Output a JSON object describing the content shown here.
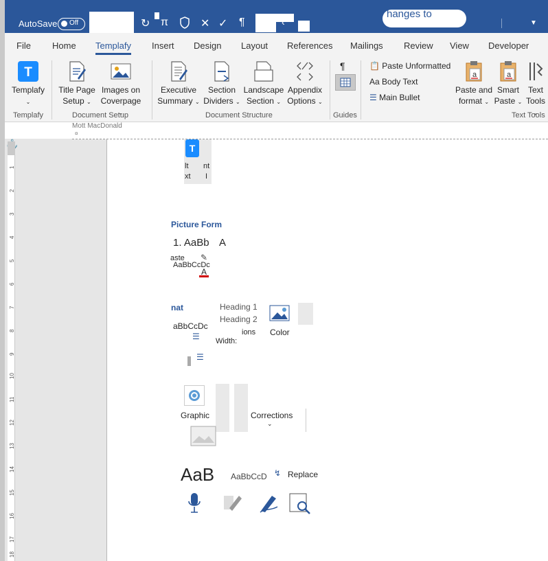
{
  "titlebar": {
    "autosave_label": "AutoSave",
    "autosave_state": "Off",
    "doc_title_fragment": "hanges to",
    "qa_icons": [
      "undo-icon",
      "pi-icon",
      "shield-icon",
      "close-x-icon",
      "check-icon",
      "pilcrow-icon",
      "stamp-icon",
      "back-arrow-icon"
    ]
  },
  "tabs": [
    "File",
    "Home",
    "Templafy",
    "Insert",
    "Design",
    "Layout",
    "References",
    "Mailings",
    "Review",
    "View",
    "Developer"
  ],
  "active_tab": "Templafy",
  "ribbon": {
    "groups": {
      "templafy": "Templafy",
      "document_setup": "Document Setup",
      "document_structure": "Document Structure",
      "guides": "Guides",
      "text_tools": "Text Tools"
    },
    "buttons": {
      "templafy": "Templafy",
      "title_page_1": "Title Page",
      "title_page_2": "Setup",
      "images_1": "Images on",
      "images_2": "Coverpage",
      "exec_1": "Executive",
      "exec_2": "Summary",
      "section_1": "Section",
      "section_2": "Dividers",
      "landscape_1": "Landscape",
      "landscape_2": "Section",
      "appendix_1": "Appendix",
      "appendix_2": "Options",
      "paste_unformatted": "Paste Unformatted",
      "body_text": "Body Text",
      "main_bullet": "Main Bullet",
      "paste_format_1": "Paste and",
      "paste_format_2": "format",
      "smart_paste_1": "Smart",
      "smart_paste_2": "Paste",
      "text_tools_1": "Text",
      "text_tools_2": "Tools"
    }
  },
  "document": {
    "header_label": "Mott MacDonald",
    "header_mark": "¤",
    "ruler_numbers": [
      "1",
      "2",
      "3",
      "4",
      "5",
      "6",
      "7",
      "8",
      "9",
      "10",
      "11",
      "12",
      "13",
      "14",
      "15",
      "16",
      "17",
      "18"
    ],
    "fragments": {
      "alt_1": "lt",
      "alt_2": "xt",
      "int_1": "nt",
      "int_2": "I",
      "picture_format": "Picture Form",
      "style_numbered": "1. AaBb",
      "style_a": "A",
      "paste_text": "aste",
      "style_sample": "AaBbCcDc",
      "font_color_a": "A",
      "format_text": "nat",
      "heading1": "Heading 1",
      "heading2": "Heading 2",
      "style_sample2": "aBbCcDc",
      "options_text": "ions",
      "color_label": "Color",
      "width_label": "Width:",
      "graphic_label": "Graphic",
      "corrections_label": "Corrections",
      "big_aab": "AaB",
      "small_aab": "AaBbCcD",
      "replace_label": "Replace"
    }
  }
}
